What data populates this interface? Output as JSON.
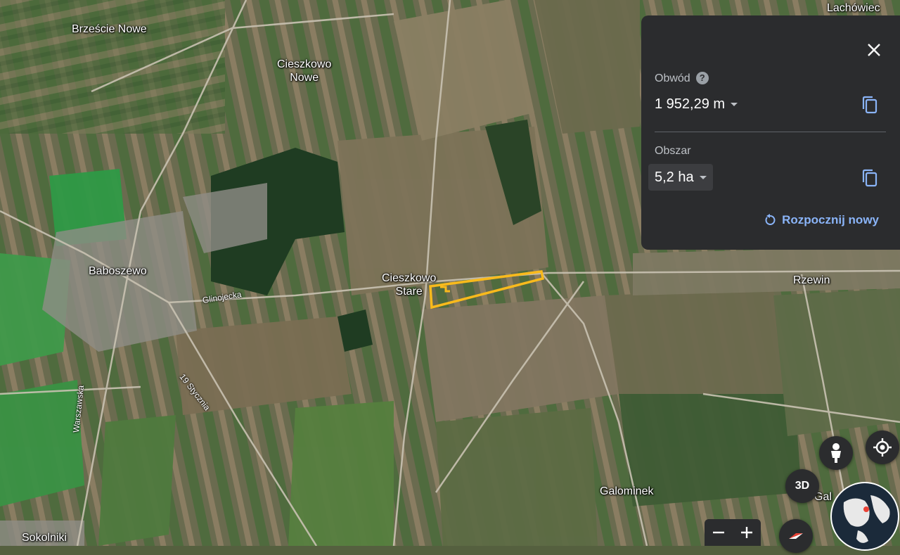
{
  "places": [
    {
      "id": "brzescie-nowe",
      "name": "Brzeście Nowe"
    },
    {
      "id": "cieszkowo-nowe",
      "name": "Cieszkowo\nNowe"
    },
    {
      "id": "lachowiec",
      "name": "Lachówiec"
    },
    {
      "id": "baboszewo",
      "name": "Baboszewo"
    },
    {
      "id": "cieszkowo-stare",
      "name": "Cieszkowo\nStare"
    },
    {
      "id": "rzewin",
      "name": "Rzewin"
    },
    {
      "id": "galominek",
      "name": "Galominek"
    },
    {
      "id": "galo-partial",
      "name": "Gal"
    },
    {
      "id": "sokolniki",
      "name": "Sokolniki"
    }
  ],
  "streets": [
    {
      "id": "glinojecka",
      "name": "Glinojecka"
    },
    {
      "id": "19-stycznia",
      "name": "19 Stycznia"
    },
    {
      "id": "warszawska",
      "name": "Warszawska"
    }
  ],
  "measure_panel": {
    "perimeter_label": "Obwód",
    "perimeter_value": "1 952,29 m",
    "area_label": "Obszar",
    "area_value": "5,2 ha",
    "restart_label": "Rozpocznij nowy"
  },
  "controls": {
    "btn_3d": "3D"
  },
  "colors": {
    "panel_bg": "#2b2c2e",
    "accent": "#8ab4f8",
    "polygon": "#f9ba1c",
    "secondary_text": "#bdc1c6"
  },
  "icons": [
    "close-icon",
    "help-icon",
    "copy-icon",
    "restart-icon",
    "pegman-icon",
    "my-location-icon",
    "zoom-out-icon",
    "zoom-in-icon",
    "compass-icon",
    "globe-icon"
  ]
}
